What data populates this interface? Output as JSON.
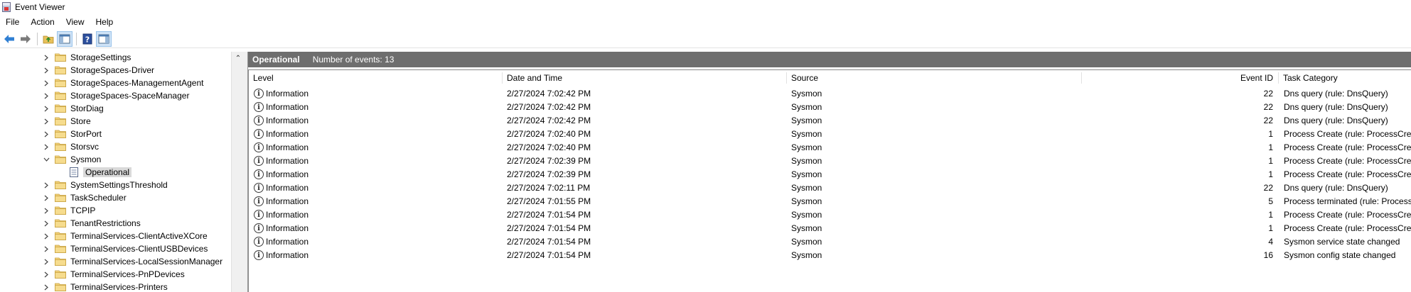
{
  "window": {
    "title": "Event Viewer"
  },
  "menu": [
    "File",
    "Action",
    "View",
    "Help"
  ],
  "toolbar": {
    "buttons": [
      "back-arrow-icon",
      "forward-arrow-icon",
      "folder-up-icon",
      "show-hide-tree-icon",
      "help-icon",
      "show-action-pane-icon"
    ]
  },
  "tree": {
    "items": [
      {
        "label": "StorageSettings",
        "expanded": false
      },
      {
        "label": "StorageSpaces-Driver",
        "expanded": false
      },
      {
        "label": "StorageSpaces-ManagementAgent",
        "expanded": false
      },
      {
        "label": "StorageSpaces-SpaceManager",
        "expanded": false
      },
      {
        "label": "StorDiag",
        "expanded": false
      },
      {
        "label": "Store",
        "expanded": false
      },
      {
        "label": "StorPort",
        "expanded": false
      },
      {
        "label": "Storsvc",
        "expanded": false
      },
      {
        "label": "Sysmon",
        "expanded": true
      },
      {
        "label": "Operational",
        "child": true,
        "selected": true
      },
      {
        "label": "SystemSettingsThreshold",
        "expanded": false
      },
      {
        "label": "TaskScheduler",
        "expanded": false
      },
      {
        "label": "TCPIP",
        "expanded": false
      },
      {
        "label": "TenantRestrictions",
        "expanded": false
      },
      {
        "label": "TerminalServices-ClientActiveXCore",
        "expanded": false
      },
      {
        "label": "TerminalServices-ClientUSBDevices",
        "expanded": false
      },
      {
        "label": "TerminalServices-LocalSessionManager",
        "expanded": false
      },
      {
        "label": "TerminalServices-PnPDevices",
        "expanded": false
      },
      {
        "label": "TerminalServices-Printers",
        "expanded": false
      }
    ]
  },
  "log_header": {
    "title": "Operational",
    "count_text": "Number of events: 13"
  },
  "columns": [
    "Level",
    "Date and Time",
    "Source",
    "Event ID",
    "Task Category"
  ],
  "events": [
    {
      "level": "Information",
      "datetime": "2/27/2024 7:02:42 PM",
      "source": "Sysmon",
      "event_id": "22",
      "task": "Dns query (rule: DnsQuery)"
    },
    {
      "level": "Information",
      "datetime": "2/27/2024 7:02:42 PM",
      "source": "Sysmon",
      "event_id": "22",
      "task": "Dns query (rule: DnsQuery)"
    },
    {
      "level": "Information",
      "datetime": "2/27/2024 7:02:42 PM",
      "source": "Sysmon",
      "event_id": "22",
      "task": "Dns query (rule: DnsQuery)"
    },
    {
      "level": "Information",
      "datetime": "2/27/2024 7:02:40 PM",
      "source": "Sysmon",
      "event_id": "1",
      "task": "Process Create (rule: ProcessCreate)"
    },
    {
      "level": "Information",
      "datetime": "2/27/2024 7:02:40 PM",
      "source": "Sysmon",
      "event_id": "1",
      "task": "Process Create (rule: ProcessCreate)"
    },
    {
      "level": "Information",
      "datetime": "2/27/2024 7:02:39 PM",
      "source": "Sysmon",
      "event_id": "1",
      "task": "Process Create (rule: ProcessCreate)"
    },
    {
      "level": "Information",
      "datetime": "2/27/2024 7:02:39 PM",
      "source": "Sysmon",
      "event_id": "1",
      "task": "Process Create (rule: ProcessCreate)"
    },
    {
      "level": "Information",
      "datetime": "2/27/2024 7:02:11 PM",
      "source": "Sysmon",
      "event_id": "22",
      "task": "Dns query (rule: DnsQuery)"
    },
    {
      "level": "Information",
      "datetime": "2/27/2024 7:01:55 PM",
      "source": "Sysmon",
      "event_id": "5",
      "task": "Process terminated (rule: ProcessTerminate)"
    },
    {
      "level": "Information",
      "datetime": "2/27/2024 7:01:54 PM",
      "source": "Sysmon",
      "event_id": "1",
      "task": "Process Create (rule: ProcessCreate)"
    },
    {
      "level": "Information",
      "datetime": "2/27/2024 7:01:54 PM",
      "source": "Sysmon",
      "event_id": "1",
      "task": "Process Create (rule: ProcessCreate)"
    },
    {
      "level": "Information",
      "datetime": "2/27/2024 7:01:54 PM",
      "source": "Sysmon",
      "event_id": "4",
      "task": "Sysmon service state changed"
    },
    {
      "level": "Information",
      "datetime": "2/27/2024 7:01:54 PM",
      "source": "Sysmon",
      "event_id": "16",
      "task": "Sysmon config state changed"
    }
  ],
  "colors": {
    "header_bar": "#6e6e6e",
    "folder": "#e8c15a",
    "accent": "#1e73c8"
  }
}
